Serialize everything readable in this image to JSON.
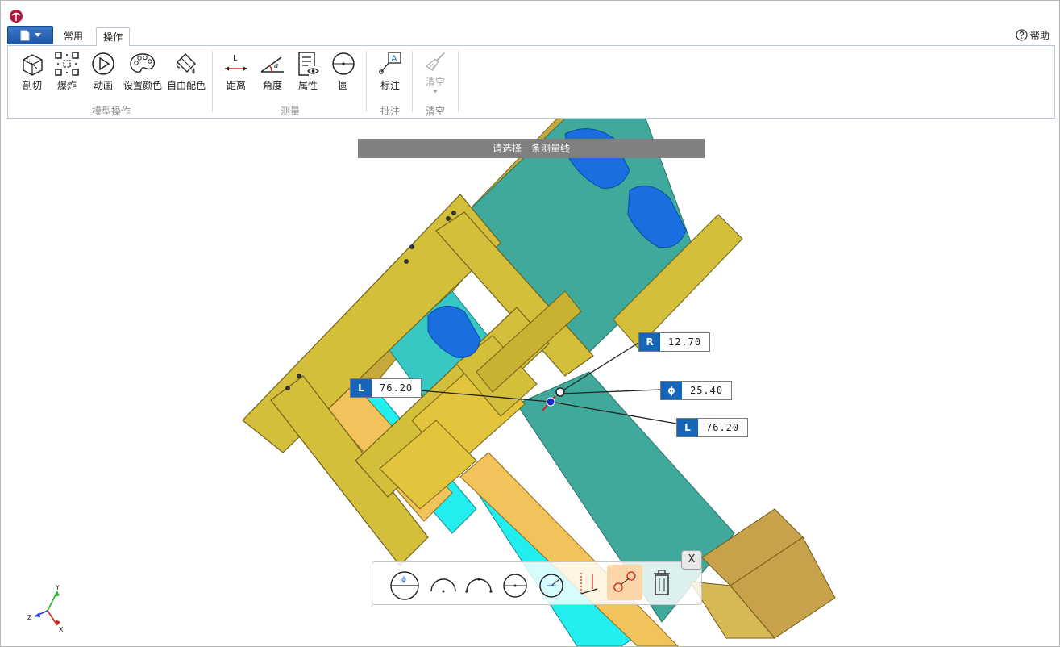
{
  "tabs": [
    {
      "label": "常用",
      "active": false
    },
    {
      "label": "操作",
      "active": true
    }
  ],
  "help_label": "帮助",
  "ribbon": {
    "groups": [
      {
        "label": "模型操作",
        "buttons": [
          "剖切",
          "爆炸",
          "动画",
          "设置颜色",
          "自由配色"
        ]
      },
      {
        "label": "测量",
        "buttons": [
          "距离",
          "角度",
          "属性",
          "圆"
        ]
      },
      {
        "label": "批注",
        "buttons": [
          "标注"
        ]
      },
      {
        "label": "清空",
        "buttons": [
          "清空"
        ]
      }
    ]
  },
  "prompt": "请选择一条测量线",
  "dimensions": [
    {
      "tag": "R",
      "value": "12.70"
    },
    {
      "tag": "ϕ",
      "value": "25.40"
    },
    {
      "tag": "L",
      "value": "76.20"
    },
    {
      "tag": "L",
      "value": "76.20"
    }
  ],
  "axes": {
    "x": "X",
    "y": "Y",
    "z": "Z"
  },
  "close_label": "X",
  "colors": {
    "frame": "#d4bf3a",
    "teal": "#3fa99b",
    "cyan": "#22eef0",
    "blue": "#1a6ee0",
    "ribbon_accent": "#1565b8",
    "toolbar_active": "#fbd6a8"
  }
}
